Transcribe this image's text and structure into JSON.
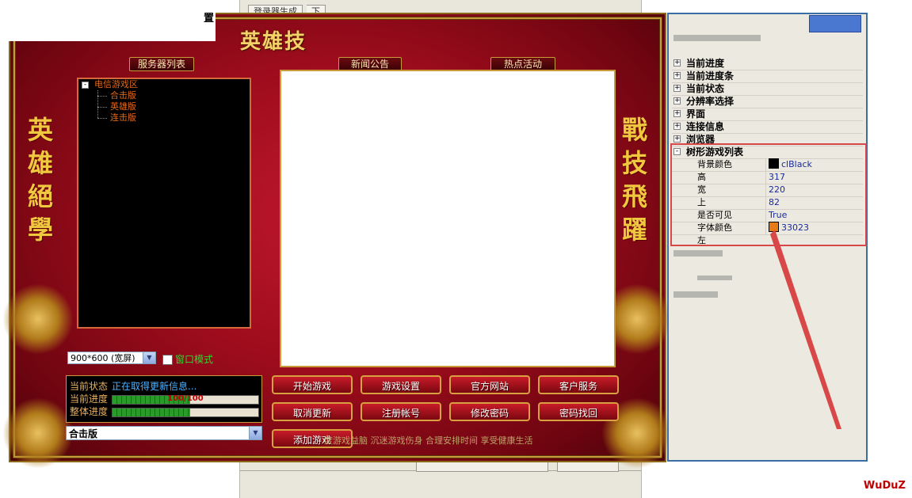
{
  "background_window": {
    "tab_active": "登录器生成",
    "tab_other": "下"
  },
  "top_label": "置",
  "launcher": {
    "title": "英雄技",
    "left_vertical": "英雄絕學",
    "right_vertical": "戰技飛躍",
    "server_list_header": "服务器列表",
    "news_header": "新闻公告",
    "events_header": "热点活动",
    "tree": {
      "root": "电信游戏区",
      "children": [
        "合击版",
        "英雄版",
        "连击版"
      ]
    },
    "resolution": "900*600 (宽屏)",
    "window_mode_label": "窗口模式",
    "status": {
      "current_state_label": "当前状态",
      "current_state_value": "正在取得更新信息...",
      "current_progress_label": "当前进度",
      "current_progress_text": "100/100",
      "current_progress": 0.53,
      "overall_progress_label": "整体进度",
      "overall_progress": 0.53
    },
    "server_select": "合击版",
    "buttons": {
      "start_game": "开始游戏",
      "game_settings": "游戏设置",
      "official_site": "官方网站",
      "customer_service": "客户服务",
      "cancel_update": "取消更新",
      "register": "注册帐号",
      "change_password": "修改密码",
      "recover_password": "密码找回",
      "add_game": "添加游戏"
    },
    "footer": "度游戏益脑 沉迷游戏伤身 合理安排时间 享受健康生活"
  },
  "inspector": {
    "categories": [
      "当前进度",
      "当前进度条",
      "当前状态",
      "分辨率选择",
      "界面",
      "连接信息",
      "浏览器",
      "树形游戏列表"
    ],
    "properties": [
      {
        "name": "背景颜色",
        "value": "clBlack",
        "swatch": "#000000"
      },
      {
        "name": "高",
        "value": "317"
      },
      {
        "name": "宽",
        "value": "220"
      },
      {
        "name": "上",
        "value": "82"
      },
      {
        "name": "是否可见",
        "value": "True"
      },
      {
        "name": "字体颜色",
        "value": "33023",
        "swatch": "#e87a18"
      },
      {
        "name": "左",
        "value": ""
      }
    ]
  },
  "colors": {
    "launcher_red": "#9c0c1c",
    "gold": "#c89a3a",
    "highlight_red": "#d84848",
    "tree_text": "#e06818",
    "status_value": "#4ab0ff",
    "window_mode_text": "#30d830"
  },
  "brand": "WuDuZ"
}
